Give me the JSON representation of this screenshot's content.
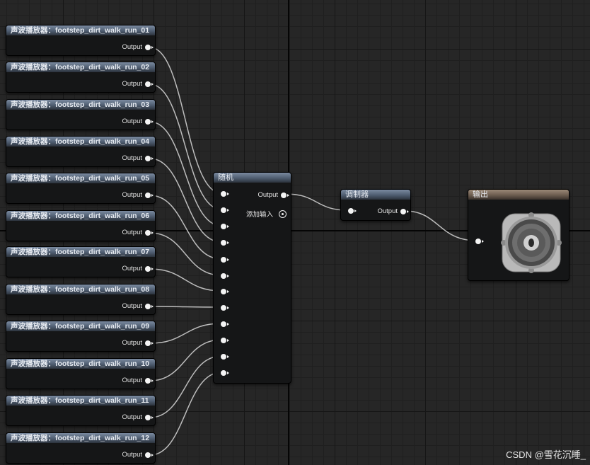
{
  "players": [
    {
      "title": "声波播放器：footstep_dirt_walk_run_01",
      "output_label": "Output"
    },
    {
      "title": "声波播放器：footstep_dirt_walk_run_02",
      "output_label": "Output"
    },
    {
      "title": "声波播放器：footstep_dirt_walk_run_03",
      "output_label": "Output"
    },
    {
      "title": "声波播放器：footstep_dirt_walk_run_04",
      "output_label": "Output"
    },
    {
      "title": "声波播放器：footstep_dirt_walk_run_05",
      "output_label": "Output"
    },
    {
      "title": "声波播放器：footstep_dirt_walk_run_06",
      "output_label": "Output"
    },
    {
      "title": "声波播放器：footstep_dirt_walk_run_07",
      "output_label": "Output"
    },
    {
      "title": "声波播放器：footstep_dirt_walk_run_08",
      "output_label": "Output"
    },
    {
      "title": "声波播放器：footstep_dirt_walk_run_09",
      "output_label": "Output"
    },
    {
      "title": "声波播放器：footstep_dirt_walk_run_10",
      "output_label": "Output"
    },
    {
      "title": "声波播放器：footstep_dirt_walk_run_11",
      "output_label": "Output"
    },
    {
      "title": "声波播放器：footstep_dirt_walk_run_12",
      "output_label": "Output"
    }
  ],
  "random_node": {
    "title": "随机",
    "output_label": "Output",
    "add_input_label": "添加输入"
  },
  "modulator_node": {
    "title": "调制器",
    "output_label": "Output"
  },
  "output_node": {
    "title": "输出",
    "icon": "speaker-icon"
  },
  "watermark": "CSDN @雪花沉睡_",
  "colors": {
    "background": "#262626",
    "wire": "#bdbdbd",
    "player_header": "#5c6b80",
    "output_header": "#7a6a5c"
  }
}
